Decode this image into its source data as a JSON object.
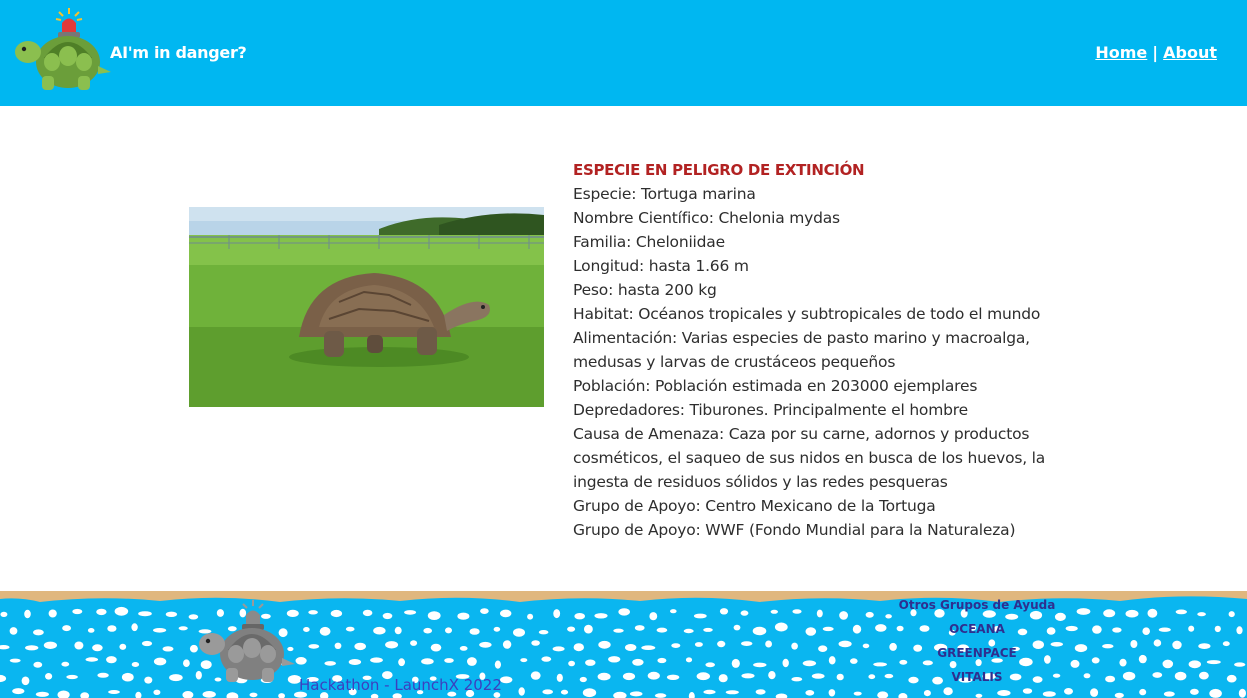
{
  "header": {
    "brand": "AI'm in danger?",
    "nav": {
      "home": "Home",
      "separator": "|",
      "about": "About"
    },
    "logo_icon": "turtle-with-siren-icon"
  },
  "main": {
    "image_alt": "Tortuga caminando sobre pasto",
    "alert": "ESPECIE EN PELIGRO DE EXTINCIÓN",
    "lines": [
      "Especie: Tortuga marina",
      "Nombre Científico: Chelonia mydas",
      "Familia: Cheloniidae",
      "Longitud: hasta 1.66 m",
      "Peso: hasta 200 kg",
      "Habitat: Océanos tropicales y subtropicales de todo el mundo",
      "Alimentación: Varias especies de pasto marino y macroalga, medusas y larvas de crustáceos pequeños",
      "Población: Población estimada en 203000 ejemplares",
      "Depredadores: Tiburones. Principalmente el hombre",
      "Causa de Amenaza: Caza por su carne, adornos y productos cosméticos, el saqueo de sus nidos en busca de los huevos, la ingesta de residuos sólidos y las redes pesqueras",
      "Grupo de Apoyo: Centro Mexicano de la Tortuga",
      "Grupo de Apoyo: WWF (Fondo Mundial para la Naturaleza)"
    ]
  },
  "footer": {
    "credit": "Hackathon - LaunchX 2022",
    "groups_title": "Otros Grupos de Ayuda",
    "groups": [
      "OCEANA",
      "GREENPACE",
      "VITALIS"
    ],
    "logo_icon": "gray-turtle-with-siren-icon"
  },
  "colors": {
    "header_bg": "#00b7f1",
    "alert": "#b22222",
    "sand": "#e0b77e",
    "footer_link": "#2f2f8f"
  }
}
